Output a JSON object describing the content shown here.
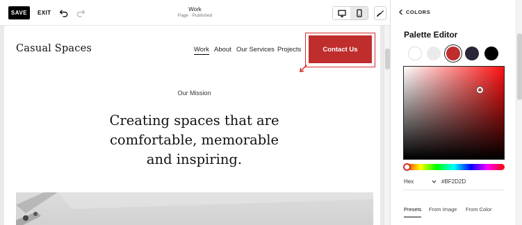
{
  "toolbar": {
    "save_label": "SAVE",
    "exit_label": "EXIT",
    "undo_icon": "undo-icon",
    "redo_icon": "redo-icon",
    "page_title": "Work",
    "page_status": "Page · Published",
    "desktop_icon": "desktop-icon",
    "mobile_icon": "mobile-icon",
    "style_icon": "paintbrush-icon"
  },
  "site": {
    "title": "Casual Spaces",
    "nav": [
      "Work",
      "About",
      "Our Services",
      "Projects"
    ],
    "cta_label": "Contact Us",
    "mission_label": "Our Mission",
    "headline_lines": [
      "Creating spaces that are",
      "comfortable, memorable",
      "and inspiring."
    ]
  },
  "panel": {
    "back_label": "COLORS",
    "title": "Palette Editor",
    "swatches": [
      "#ffffff",
      "#ebebeb",
      "#bf2d2d",
      "#2b2436",
      "#000000"
    ],
    "selected_swatch": 2,
    "hex_mode": "Hex",
    "hex_value": "#BF2D2D",
    "tabs": [
      "Presets",
      "From Image",
      "From Color"
    ],
    "active_tab": 0
  },
  "colors": {
    "accent": "#bf2d2d",
    "selection_outline": "#d22b2b"
  }
}
